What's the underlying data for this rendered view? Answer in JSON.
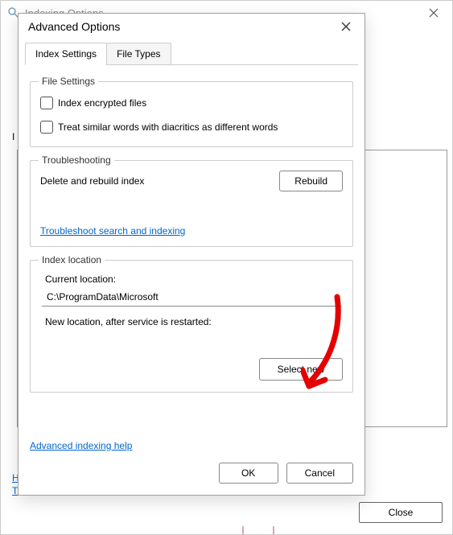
{
  "parent": {
    "title": "Indexing Options",
    "left_label": "I",
    "close_label": "Close",
    "link_h": "H",
    "link_t": "T"
  },
  "dialog": {
    "title": "Advanced Options",
    "tabs": {
      "active": "Index Settings",
      "inactive": "File Types"
    },
    "file_settings": {
      "legend": "File Settings",
      "encrypted": "Index encrypted files",
      "diacritics": "Treat similar words with diacritics as different words"
    },
    "troubleshooting": {
      "legend": "Troubleshooting",
      "rebuild_text": "Delete and rebuild index",
      "rebuild_btn": "Rebuild",
      "link": "Troubleshoot search and indexing"
    },
    "location": {
      "legend": "Index location",
      "current_label": "Current location:",
      "current_value": "C:\\ProgramData\\Microsoft",
      "new_label": "New location, after service is restarted:",
      "new_value": "",
      "select_btn": "Select new"
    },
    "help_link": "Advanced indexing help",
    "ok": "OK",
    "cancel": "Cancel"
  }
}
